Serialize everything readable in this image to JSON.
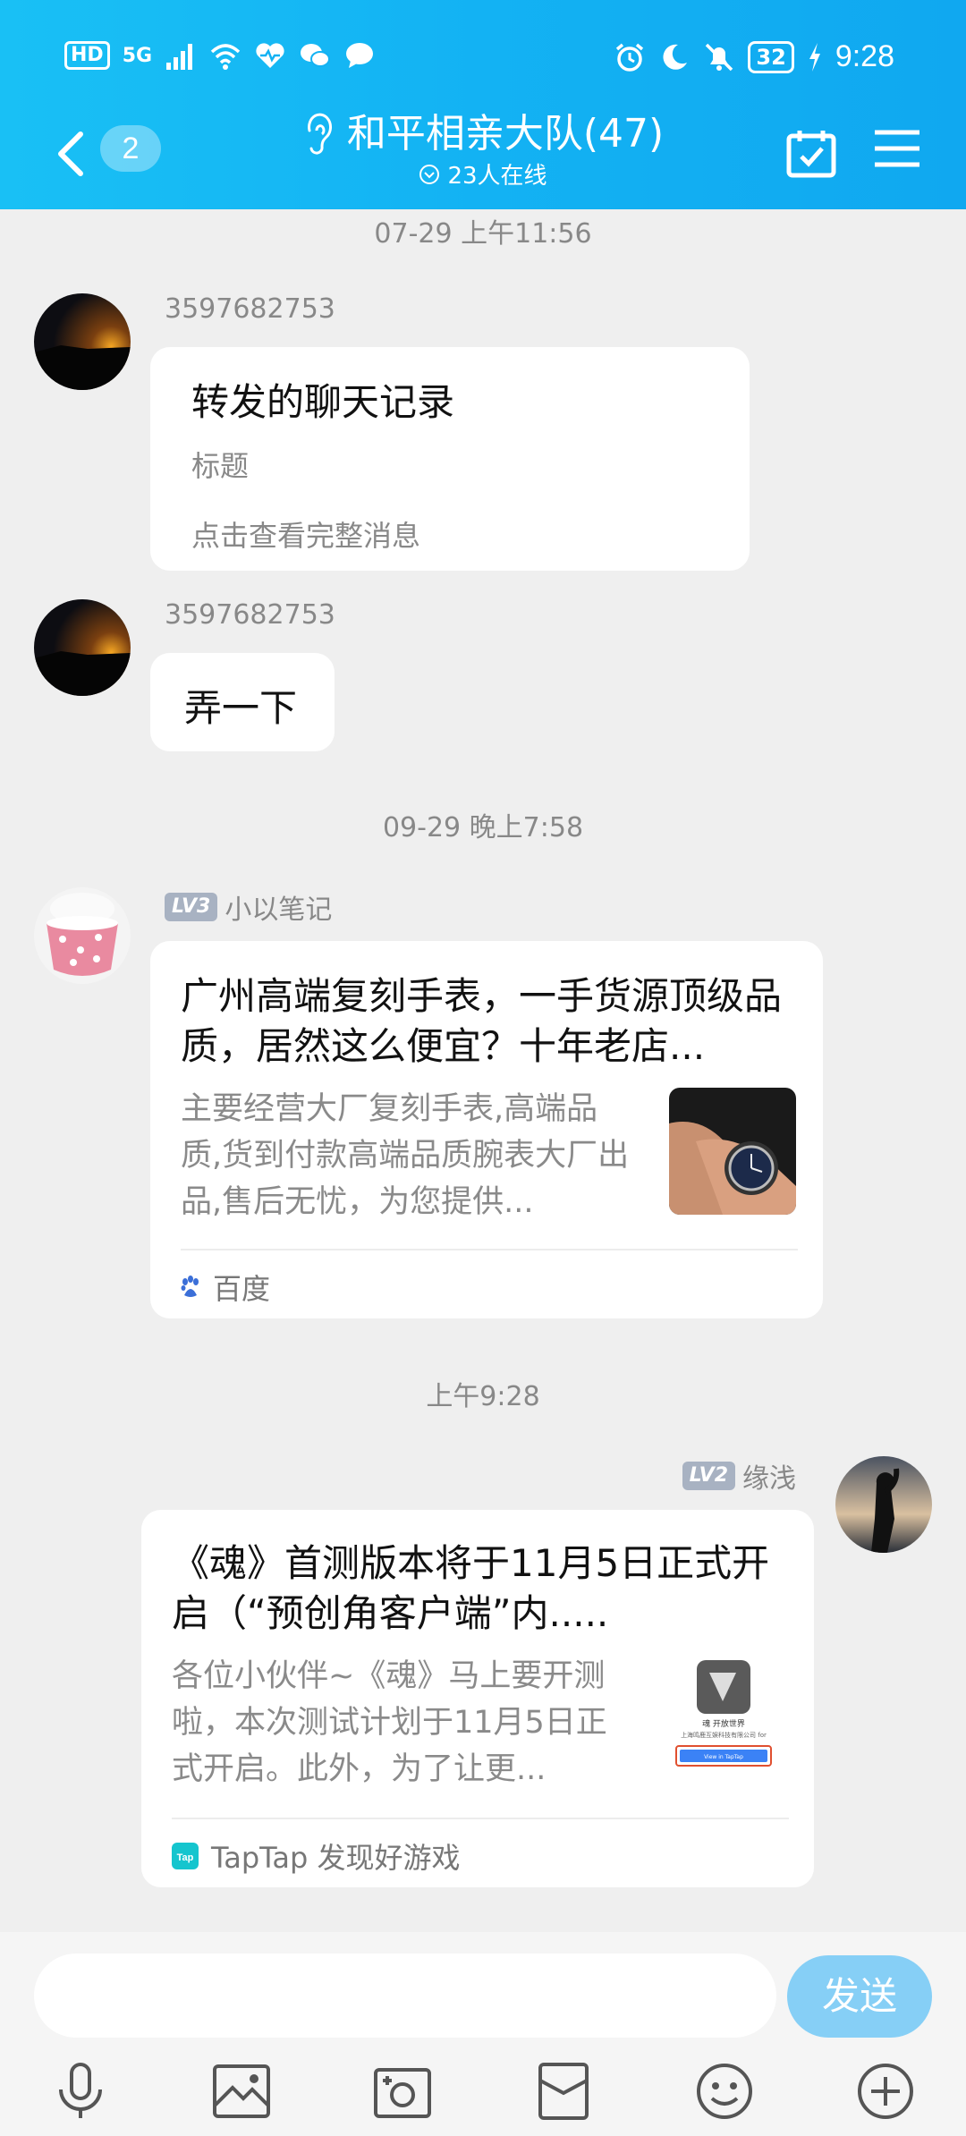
{
  "status_bar": {
    "network": "HD",
    "signal": "5G",
    "battery": "32",
    "time": "9:28"
  },
  "header": {
    "unread_count": "2",
    "title": "和平相亲大队(47)",
    "online": "23人在线"
  },
  "messages": [
    {
      "timestamp": "07-29 上午11:56"
    },
    {
      "sender": "3597682753",
      "forward_title": "转发的聊天记录",
      "forward_sub": "标题",
      "forward_more": "点击查看完整消息"
    },
    {
      "sender": "3597682753",
      "text": "弄一下"
    },
    {
      "timestamp": "09-29 晚上7:58"
    },
    {
      "level": "LV3",
      "sender": "小以笔记",
      "card_title": "广州高端复刻手表，一手货源顶级品质，居然这么便宜？十年老店...",
      "card_desc": "主要经营大厂复刻手表,高端品质,货到付款高端品质腕表大厂出品,售后无忧，为您提供...",
      "card_source": "百度"
    },
    {
      "timestamp": "上午9:28"
    },
    {
      "level": "LV2",
      "sender": "缘浅",
      "card_title": "《魂》首测版本将于11月5日正式开启（“预创角客户端”内.....",
      "card_desc": "各位小伙伴~《魂》马上要开测啦，本次测试计划于11月5日正式开启。此外，为了让更...",
      "card_source": "TapTap 发现好游戏",
      "thumb_caption1": "魂 开放世界",
      "thumb_caption2": "上海鸣鹿互娱科技有限公司 for",
      "thumb_button": "View in TapTap"
    }
  ],
  "input": {
    "placeholder": "",
    "send_label": "发送"
  },
  "toolbar": [
    "microphone-icon",
    "photo-icon",
    "camera-icon",
    "red-packet-icon",
    "emoji-icon",
    "plus-icon"
  ]
}
